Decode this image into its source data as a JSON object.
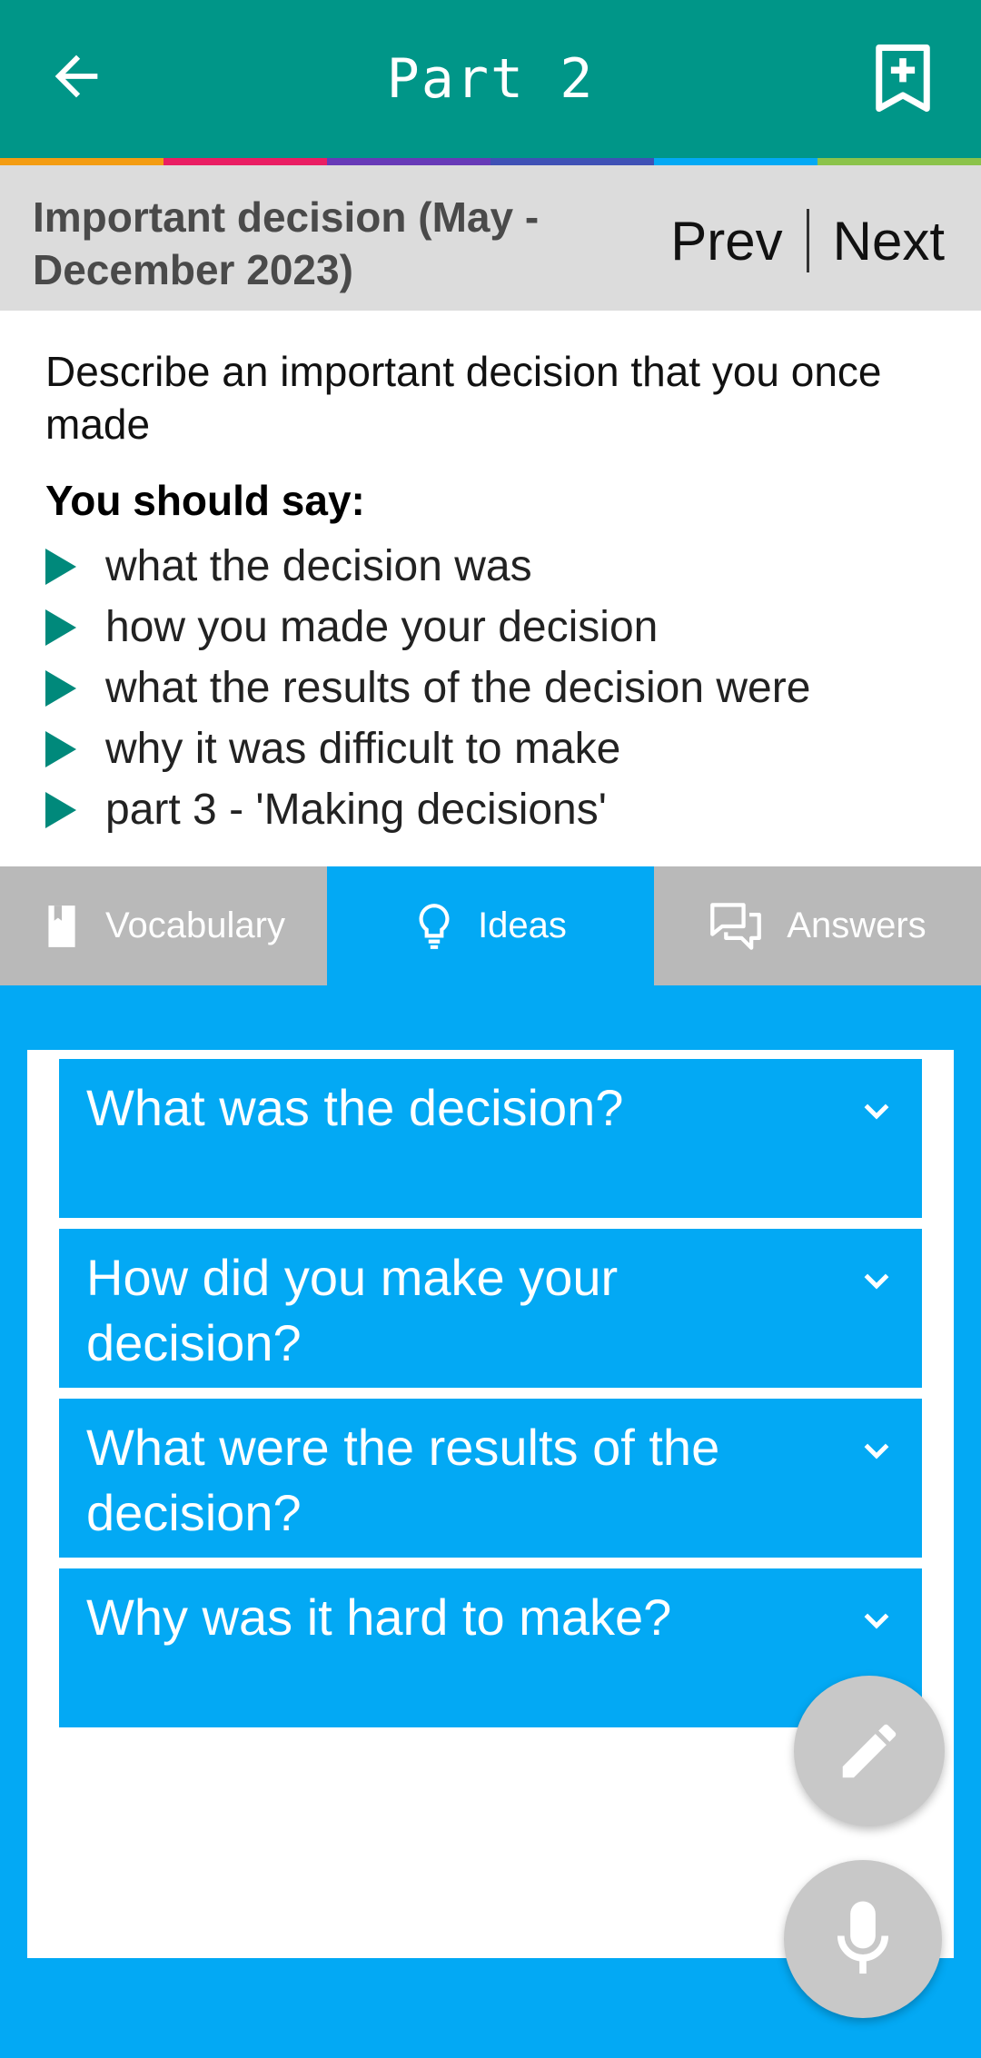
{
  "appbar": {
    "title": "Part 2",
    "back_icon": "arrow-left-icon",
    "bookmark_icon": "bookmark-add-icon",
    "color": "#009688"
  },
  "strip_colors": [
    "#f39c12",
    "#e91e63",
    "#673ab7",
    "#3f51b5",
    "#03a9f4",
    "#8bc34a"
  ],
  "topic": {
    "title": "Important decision (May - December 2023)",
    "prev_label": "Prev",
    "next_label": "Next"
  },
  "prompt": {
    "question": "Describe an important decision that you once made",
    "should_say": "You should say:",
    "cues": [
      "what the decision was",
      "how you made your decision",
      "what the results of the decision were",
      "why it was difficult to make",
      "part 3 - 'Making decisions'"
    ]
  },
  "tabs": [
    {
      "label": "Vocabulary",
      "icon": "book-icon",
      "active": false
    },
    {
      "label": "Ideas",
      "icon": "lightbulb-icon",
      "active": true
    },
    {
      "label": "Answers",
      "icon": "chat-icon",
      "active": false
    }
  ],
  "accordion": [
    {
      "question": "What was the decision?"
    },
    {
      "question": "How did you make your decision?"
    },
    {
      "question": "What were the results of the decision?"
    },
    {
      "question": "Why was it hard to make?"
    }
  ],
  "fabs": {
    "edit_icon": "pencil-icon",
    "mic_icon": "microphone-icon"
  },
  "colors": {
    "accent": "#03a9f4",
    "tab_inactive": "#b9b9b9",
    "bullet": "#00897b"
  }
}
